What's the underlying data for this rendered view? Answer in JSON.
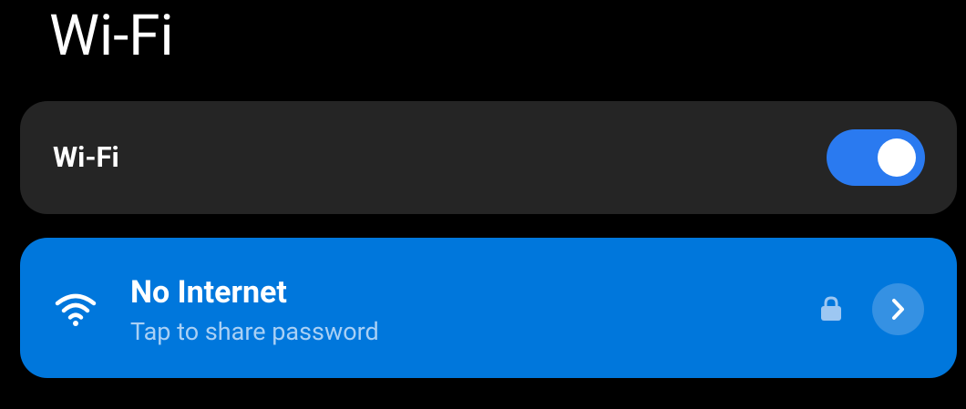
{
  "page": {
    "title": "Wi-Fi"
  },
  "wifi_toggle": {
    "label": "Wi-Fi",
    "state": "on",
    "accent_color": "#2a7af0"
  },
  "network": {
    "name": "No Internet",
    "status": "Tap to share password",
    "icon": "wifi-signal-icon",
    "secured": true,
    "secured_icon": "lock-icon",
    "detail_icon": "chevron-right-icon",
    "card_color": "#0077dc"
  }
}
